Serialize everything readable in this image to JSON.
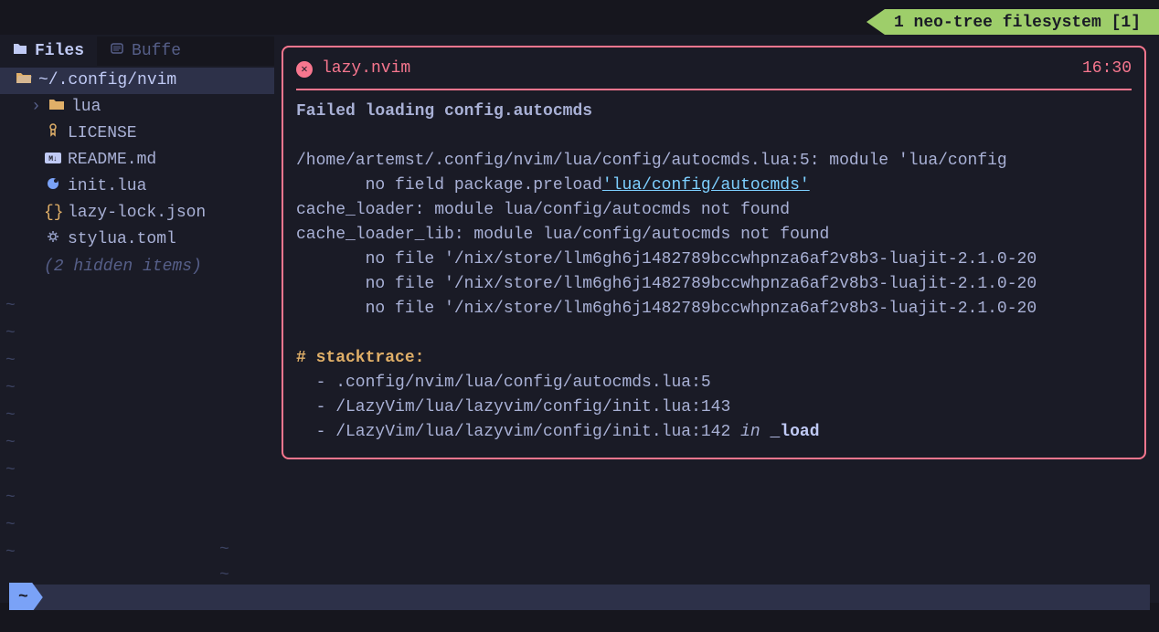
{
  "winbar": {
    "label": "1 neo-tree filesystem [1]"
  },
  "sidebar": {
    "tabs": [
      {
        "label": "Files",
        "active": true
      },
      {
        "label": "Buffe",
        "active": false
      }
    ],
    "root": "~/.config/nvim",
    "items": [
      {
        "icon": "folder",
        "label": "lua",
        "expandable": true
      },
      {
        "icon": "license",
        "label": "LICENSE"
      },
      {
        "icon": "md",
        "label": "README.md"
      },
      {
        "icon": "lua",
        "label": "init.lua"
      },
      {
        "icon": "json",
        "label": "lazy-lock.json"
      },
      {
        "icon": "toml",
        "label": "stylua.toml"
      }
    ],
    "hidden_hint": "(2 hidden items)"
  },
  "notification": {
    "title": "lazy.nvim",
    "time": "16:30",
    "heading": "Failed loading config.autocmds",
    "path_line": "/home/artemst/.config/nvim/lua/config/autocmds.lua:5: module 'lua/config",
    "preload_prefix": "       no field package.preload",
    "preload_link": "'lua/config/autocmds'",
    "cache1": "cache_loader: module lua/config/autocmds not found",
    "cache2": "cache_loader_lib: module lua/config/autocmds not found",
    "nofile1": "       no file '/nix/store/llm6gh6j1482789bccwhpnza6af2v8b3-luajit-2.1.0-20",
    "nofile2": "       no file '/nix/store/llm6gh6j1482789bccwhpnza6af2v8b3-luajit-2.1.0-20",
    "nofile3": "       no file '/nix/store/llm6gh6j1482789bccwhpnza6af2v8b3-luajit-2.1.0-20",
    "stacktrace_label": "# stacktrace:",
    "stack1": "  - .config/nvim/lua/config/autocmds.lua:5",
    "stack2": "  - /LazyVim/lua/lazyvim/config/init.lua:143",
    "stack3_prefix": "  - /LazyVim/lua/lazyvim/config/init.lua:142 ",
    "stack3_in": "in ",
    "stack3_func": "_load"
  },
  "statusline": {
    "cwd": "~"
  }
}
